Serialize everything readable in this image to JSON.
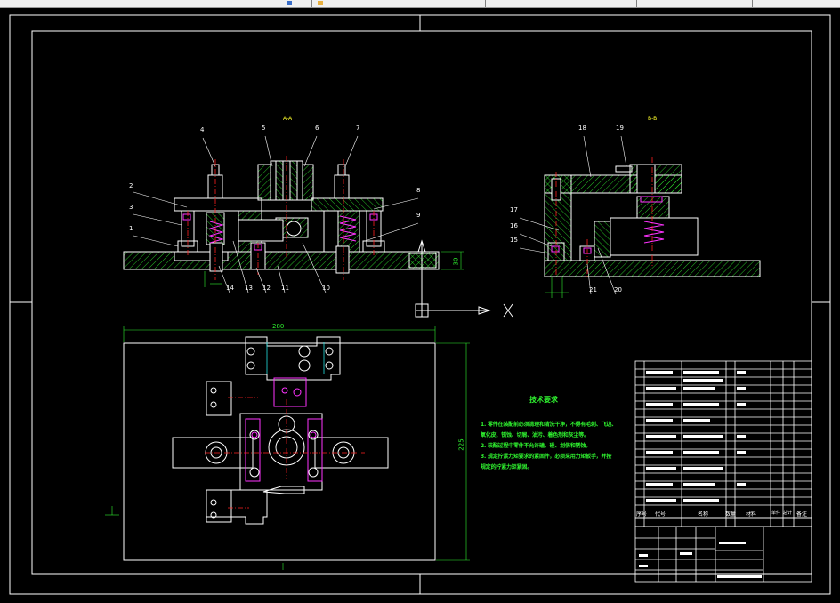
{
  "section_labels": {
    "a": "A-A",
    "b": "B-B"
  },
  "part_numbers": [
    "1",
    "2",
    "3",
    "4",
    "5",
    "6",
    "7",
    "8",
    "9",
    "10",
    "11",
    "12",
    "13",
    "14",
    "15",
    "16",
    "17",
    "18",
    "19",
    "20",
    "21"
  ],
  "dimensions": {
    "overall_width": "280",
    "overall_height": "225",
    "base_height": "30"
  },
  "ucs": {
    "x_label": "X"
  },
  "technical_requirements": {
    "title": "技术要求",
    "lines": [
      "1. 零件在装配前必须清理和清洗干净，不得有毛刺、飞边、",
      "氧化皮、锈蚀、切屑、油污、着色剂和灰尘等。",
      "2. 装配过程中零件不允许磕、碰、划伤和锈蚀。",
      "3. 规定拧紧力矩要求的紧固件，必须采用力矩扳手，并按",
      "规定的拧紧力矩紧固。"
    ]
  },
  "title_block_headers": [
    "序号",
    "代号",
    "名称",
    "数量",
    "材料",
    "单件",
    "总计",
    "备注"
  ],
  "colors": {
    "background": "#000000",
    "outline": "#ffffff",
    "hatch": "#2ff22f",
    "center_line": "#ff2020",
    "magenta": "#ff33ff",
    "cyan": "#22e0e0",
    "yellow": "#ffff2a"
  }
}
